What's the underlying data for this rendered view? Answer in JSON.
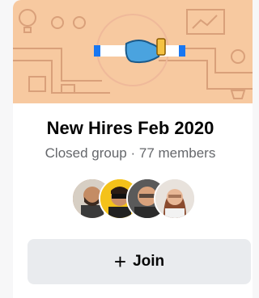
{
  "group": {
    "name": "New Hires Feb 2020",
    "meta": "Closed group · 77 members"
  },
  "join_button": {
    "icon": "+",
    "label": "Join"
  },
  "colors": {
    "cover": "#f7c9a0",
    "button_bg": "#e9ebee",
    "subtext": "#65676b"
  }
}
